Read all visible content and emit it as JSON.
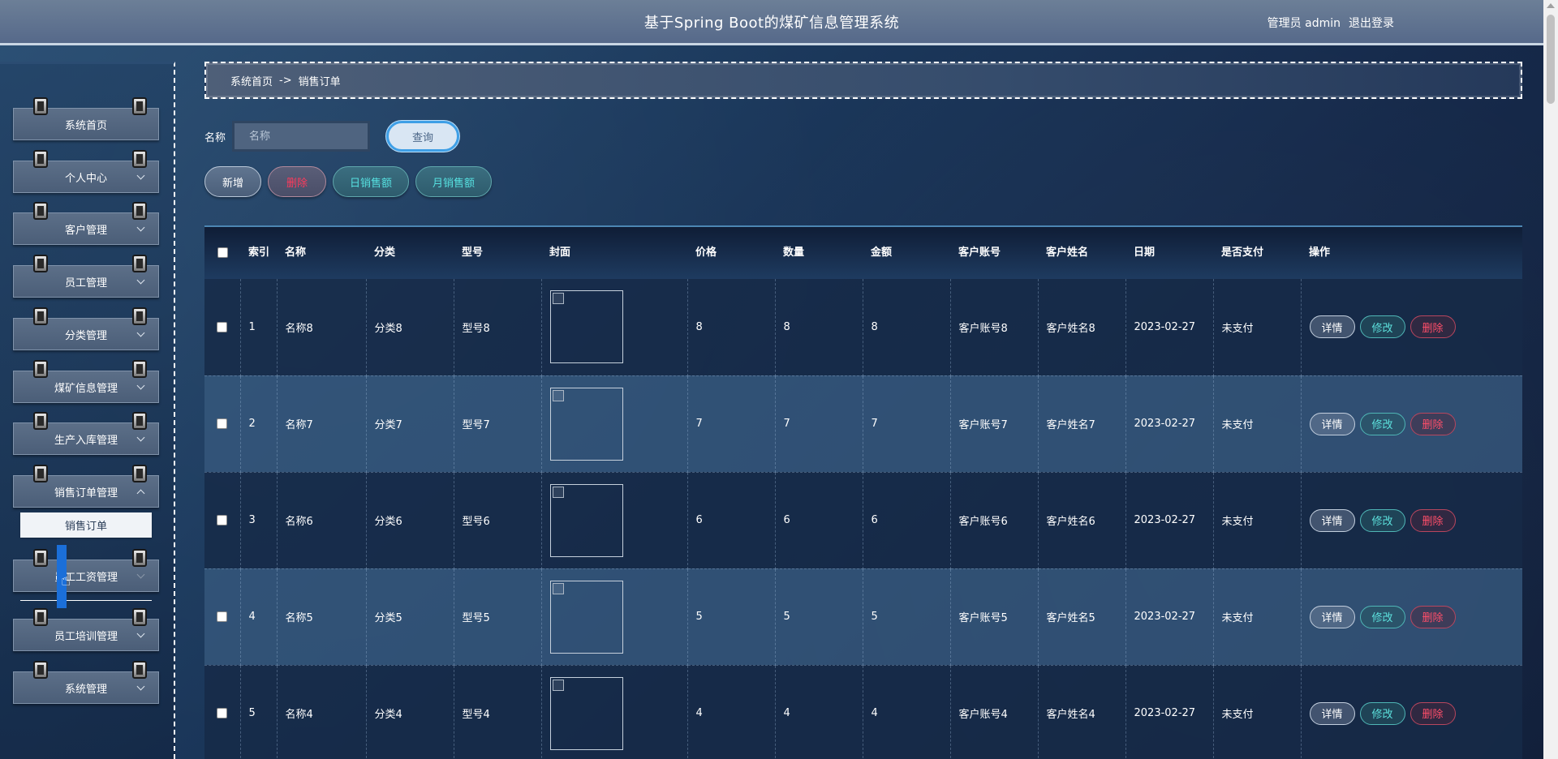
{
  "header": {
    "title": "基于Spring Boot的煤矿信息管理系统",
    "user": "管理员 admin",
    "logout": "退出登录"
  },
  "sidebar": {
    "items": [
      {
        "label": "系统首页",
        "has_chevron": false
      },
      {
        "label": "个人中心",
        "has_chevron": true
      },
      {
        "label": "客户管理",
        "has_chevron": true
      },
      {
        "label": "员工管理",
        "has_chevron": true
      },
      {
        "label": "分类管理",
        "has_chevron": true
      },
      {
        "label": "煤矿信息管理",
        "has_chevron": true
      },
      {
        "label": "生产入库管理",
        "has_chevron": true
      },
      {
        "label": "销售订单管理",
        "has_chevron": true,
        "expanded": true
      }
    ],
    "submenu_active": "销售订单",
    "after_items": [
      {
        "label": "员工工资管理"
      },
      {
        "label": "员工培训管理"
      },
      {
        "label": "系统管理"
      }
    ]
  },
  "breadcrumb": {
    "home": "系统首页",
    "sep": "->",
    "current": "销售订单"
  },
  "search": {
    "label": "名称",
    "placeholder": "名称",
    "button": "查询"
  },
  "actions": {
    "add": "新增",
    "delete": "删除",
    "daily_sales": "日销售额",
    "monthly_sales": "月销售额"
  },
  "table": {
    "headers": {
      "index": "索引",
      "name": "名称",
      "category": "分类",
      "model": "型号",
      "cover": "封面",
      "price": "价格",
      "quantity": "数量",
      "amount": "金额",
      "customer_account": "客户账号",
      "customer_name": "客户姓名",
      "date": "日期",
      "paid": "是否支付",
      "ops": "操作"
    },
    "rows": [
      {
        "index": "1",
        "name": "名称8",
        "category": "分类8",
        "model": "型号8",
        "price": "8",
        "quantity": "8",
        "amount": "8",
        "customer_account": "客户账号8",
        "customer_name": "客户姓名8",
        "date": "2023-02-27",
        "paid": "未支付"
      },
      {
        "index": "2",
        "name": "名称7",
        "category": "分类7",
        "model": "型号7",
        "price": "7",
        "quantity": "7",
        "amount": "7",
        "customer_account": "客户账号7",
        "customer_name": "客户姓名7",
        "date": "2023-02-27",
        "paid": "未支付"
      },
      {
        "index": "3",
        "name": "名称6",
        "category": "分类6",
        "model": "型号6",
        "price": "6",
        "quantity": "6",
        "amount": "6",
        "customer_account": "客户账号6",
        "customer_name": "客户姓名6",
        "date": "2023-02-27",
        "paid": "未支付"
      },
      {
        "index": "4",
        "name": "名称5",
        "category": "分类5",
        "model": "型号5",
        "price": "5",
        "quantity": "5",
        "amount": "5",
        "customer_account": "客户账号5",
        "customer_name": "客户姓名5",
        "date": "2023-02-27",
        "paid": "未支付"
      },
      {
        "index": "5",
        "name": "名称4",
        "category": "分类4",
        "model": "型号4",
        "price": "4",
        "quantity": "4",
        "amount": "4",
        "customer_account": "客户账号4",
        "customer_name": "客户姓名4",
        "date": "2023-02-27",
        "paid": "未支付"
      }
    ],
    "row_ops": {
      "detail": "详情",
      "edit": "修改",
      "remove": "删除"
    }
  }
}
